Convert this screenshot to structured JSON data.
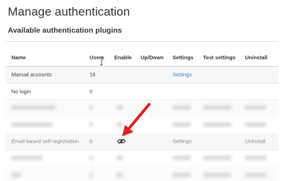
{
  "header": {
    "title": "Manage authentication",
    "section": "Available authentication plugins"
  },
  "table": {
    "columns": [
      "Name",
      "Users",
      "Enable",
      "Up/Down",
      "Settings",
      "Test settings",
      "Uninstall"
    ],
    "rows": [
      {
        "name": "Manual accounts",
        "users": "16",
        "settings": "Settings"
      },
      {
        "name": "No login",
        "users": "0"
      },
      {
        "name": "Email-based self-registration",
        "users": "0",
        "enable_icon": "eye-slash-icon",
        "settings": "Settings",
        "uninstall": "Uninstall"
      }
    ]
  },
  "colors": {
    "link": "#3a7bbf",
    "annotation_arrow": "#e02020",
    "striped_row": "#f7f7f7"
  }
}
